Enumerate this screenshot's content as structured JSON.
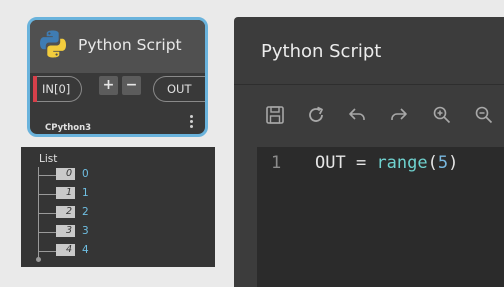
{
  "node": {
    "title": "Python Script",
    "icon": "python-logo-icon",
    "input_port": "IN[0]",
    "add_label": "+",
    "remove_label": "−",
    "output_port": "OUT",
    "engine": "CPython3",
    "selected_border_color": "#6ab3dc",
    "input_port_marker_color": "#d7404a"
  },
  "preview": {
    "title": "List",
    "items": [
      {
        "index": "0",
        "value": "0"
      },
      {
        "index": "1",
        "value": "1"
      },
      {
        "index": "2",
        "value": "2"
      },
      {
        "index": "3",
        "value": "3"
      },
      {
        "index": "4",
        "value": "4"
      }
    ],
    "value_color": "#6fbfe3"
  },
  "editor": {
    "title": "Python Script",
    "toolbar": [
      "save-icon",
      "run-icon",
      "undo-icon",
      "redo-icon",
      "zoom-in-icon",
      "zoom-out-icon"
    ],
    "code": {
      "line_number": "1",
      "var": "OUT",
      "op": " = ",
      "fn": "range",
      "open": "(",
      "arg": "5",
      "close": ")"
    }
  }
}
